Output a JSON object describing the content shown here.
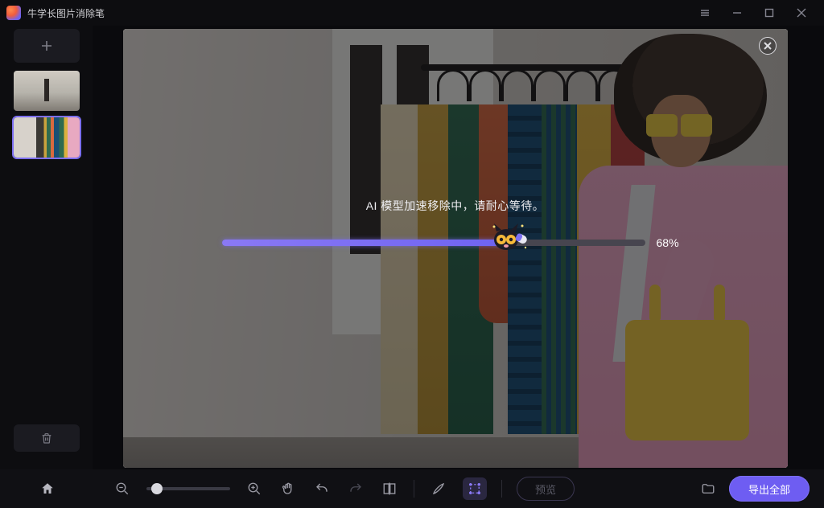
{
  "app": {
    "title": "牛学长图片消除笔"
  },
  "progress": {
    "label": "AI 模型加速移除中，请耐心等待。",
    "percent": 68,
    "percent_text": "68%"
  },
  "toolbar": {
    "preview_label": "预览",
    "export_label": "导出全部"
  },
  "colors": {
    "accent": "#6e5df2"
  }
}
